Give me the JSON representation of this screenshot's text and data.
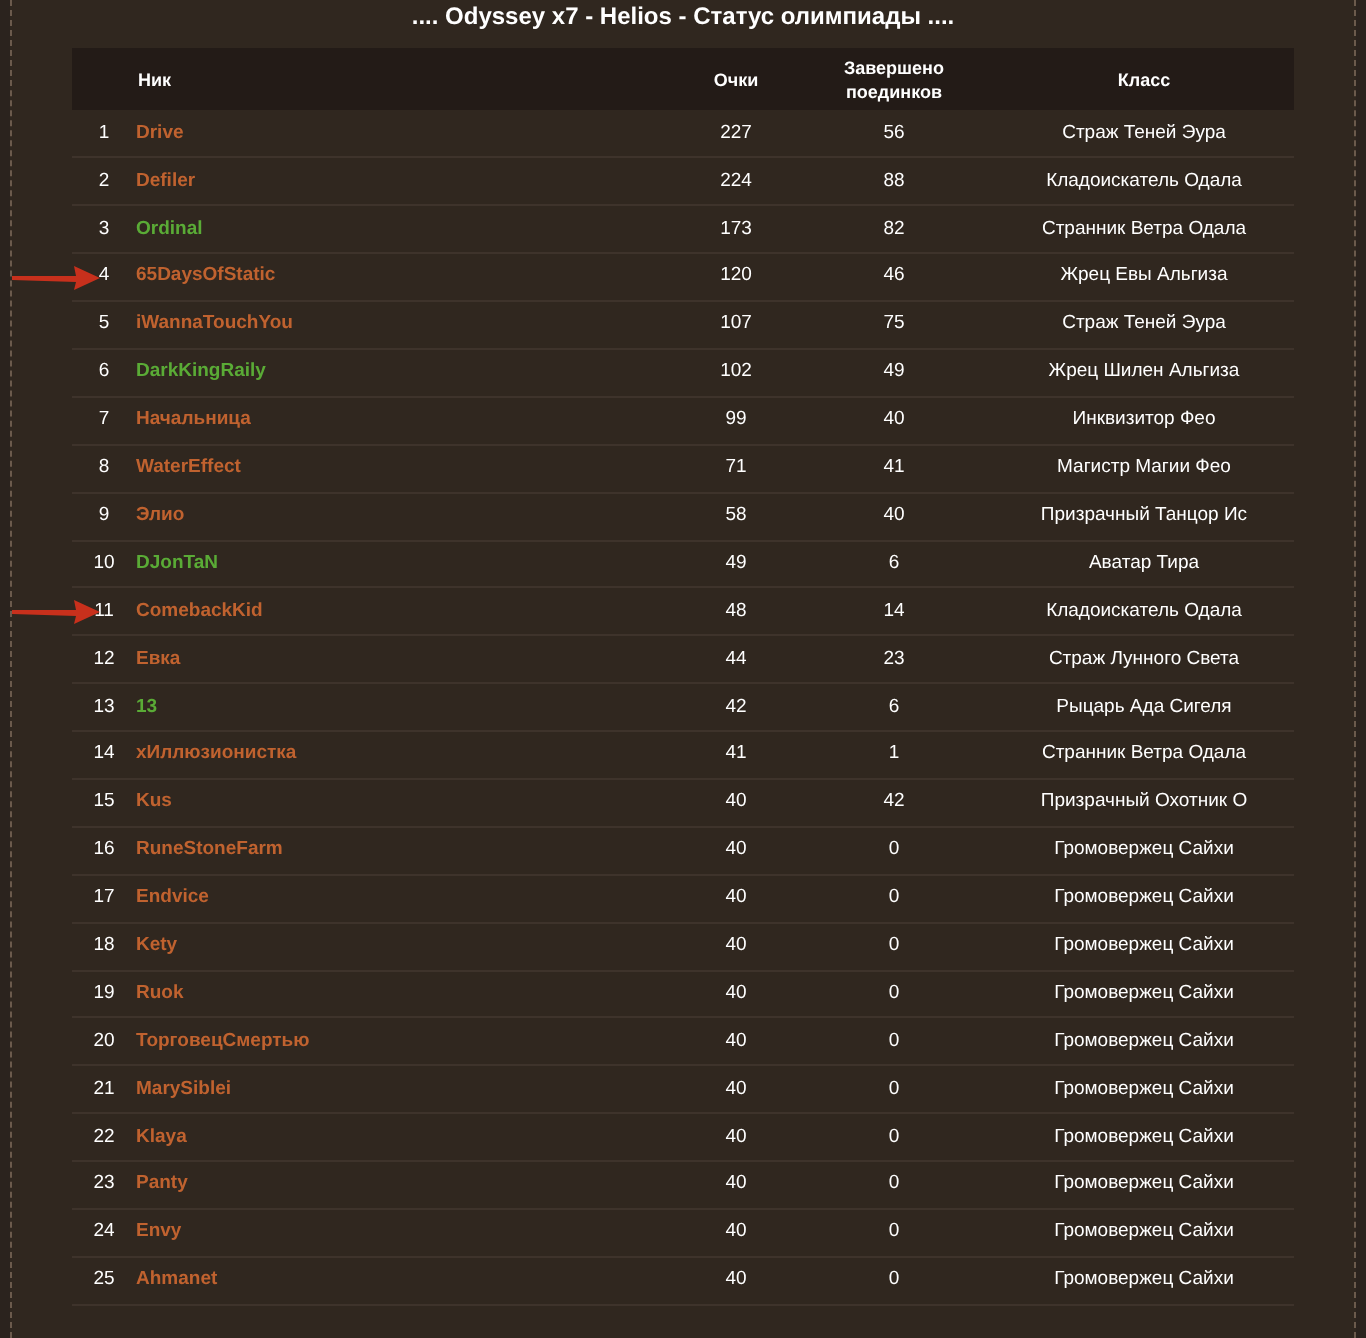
{
  "title": ".... Odyssey x7 - Helios - Статус олимпиады ....",
  "table": {
    "columns": [
      "",
      "Ник",
      "Очки",
      "Завершено поединков",
      "Класс"
    ],
    "rows": [
      {
        "rank": "1",
        "nick": "Drive",
        "color": "#c0622f",
        "points": "227",
        "duels": "56",
        "class": "Страж Теней Эура",
        "marked": false
      },
      {
        "rank": "2",
        "nick": "Defiler",
        "color": "#c0622f",
        "points": "224",
        "duels": "88",
        "class": "Кладоискатель Одала",
        "marked": false
      },
      {
        "rank": "3",
        "nick": "Ordinal",
        "color": "#5aab36",
        "points": "173",
        "duels": "82",
        "class": "Странник Ветра Одала",
        "marked": false
      },
      {
        "rank": "4",
        "nick": "65DaysOfStatic",
        "color": "#c0622f",
        "points": "120",
        "duels": "46",
        "class": "Жрец Евы Альгиза",
        "marked": true
      },
      {
        "rank": "5",
        "nick": "iWannaTouchYou",
        "color": "#c0622f",
        "points": "107",
        "duels": "75",
        "class": "Страж Теней Эура",
        "marked": false
      },
      {
        "rank": "6",
        "nick": "DarkKingRaily",
        "color": "#5aab36",
        "points": "102",
        "duels": "49",
        "class": "Жрец Шилен Альгиза",
        "marked": false
      },
      {
        "rank": "7",
        "nick": "Начальница",
        "color": "#c0622f",
        "points": "99",
        "duels": "40",
        "class": "Инквизитор Фео",
        "marked": false
      },
      {
        "rank": "8",
        "nick": "WaterEffect",
        "color": "#c0622f",
        "points": "71",
        "duels": "41",
        "class": "Магистр Магии Фео",
        "marked": false
      },
      {
        "rank": "9",
        "nick": "Элио",
        "color": "#c0622f",
        "points": "58",
        "duels": "40",
        "class": "Призрачный Танцор Ис",
        "marked": false
      },
      {
        "rank": "10",
        "nick": "DJonTaN",
        "color": "#5aab36",
        "points": "49",
        "duels": "6",
        "class": "Аватар Тира",
        "marked": false
      },
      {
        "rank": "11",
        "nick": "ComebackKid",
        "color": "#c0622f",
        "points": "48",
        "duels": "14",
        "class": "Кладоискатель Одала",
        "marked": true
      },
      {
        "rank": "12",
        "nick": "Евка",
        "color": "#c0622f",
        "points": "44",
        "duels": "23",
        "class": "Страж Лунного Света",
        "marked": false
      },
      {
        "rank": "13",
        "nick": "13",
        "color": "#5aab36",
        "points": "42",
        "duels": "6",
        "class": "Рыцарь Ада Сигеля",
        "marked": false
      },
      {
        "rank": "14",
        "nick": "xИллюзионистка",
        "color": "#c0622f",
        "points": "41",
        "duels": "1",
        "class": "Странник Ветра Одала",
        "marked": false
      },
      {
        "rank": "15",
        "nick": "Kus",
        "color": "#c0622f",
        "points": "40",
        "duels": "42",
        "class": "Призрачный Охотник О",
        "marked": false
      },
      {
        "rank": "16",
        "nick": "RuneStoneFarm",
        "color": "#c0622f",
        "points": "40",
        "duels": "0",
        "class": "Громовержец Сайхи",
        "marked": false
      },
      {
        "rank": "17",
        "nick": "Endvice",
        "color": "#c0622f",
        "points": "40",
        "duels": "0",
        "class": "Громовержец Сайхи",
        "marked": false
      },
      {
        "rank": "18",
        "nick": "Kety",
        "color": "#c0622f",
        "points": "40",
        "duels": "0",
        "class": "Громовержец Сайхи",
        "marked": false
      },
      {
        "rank": "19",
        "nick": "Ruok",
        "color": "#c0622f",
        "points": "40",
        "duels": "0",
        "class": "Громовержец Сайхи",
        "marked": false
      },
      {
        "rank": "20",
        "nick": "ТорговецСмертью",
        "color": "#c0622f",
        "points": "40",
        "duels": "0",
        "class": "Громовержец Сайхи",
        "marked": false
      },
      {
        "rank": "21",
        "nick": "MarySiblei",
        "color": "#c0622f",
        "points": "40",
        "duels": "0",
        "class": "Громовержец Сайхи",
        "marked": false
      },
      {
        "rank": "22",
        "nick": "Klaya",
        "color": "#c0622f",
        "points": "40",
        "duels": "0",
        "class": "Громовержец Сайхи",
        "marked": false
      },
      {
        "rank": "23",
        "nick": "Panty",
        "color": "#c0622f",
        "points": "40",
        "duels": "0",
        "class": "Громовержец Сайхи",
        "marked": false
      },
      {
        "rank": "24",
        "nick": "Envy",
        "color": "#c0622f",
        "points": "40",
        "duels": "0",
        "class": "Громовержец Сайхи",
        "marked": false
      },
      {
        "rank": "25",
        "nick": "Ahmanet",
        "color": "#c0622f",
        "points": "40",
        "duels": "0",
        "class": "Громовержец Сайхи",
        "marked": false
      }
    ]
  }
}
